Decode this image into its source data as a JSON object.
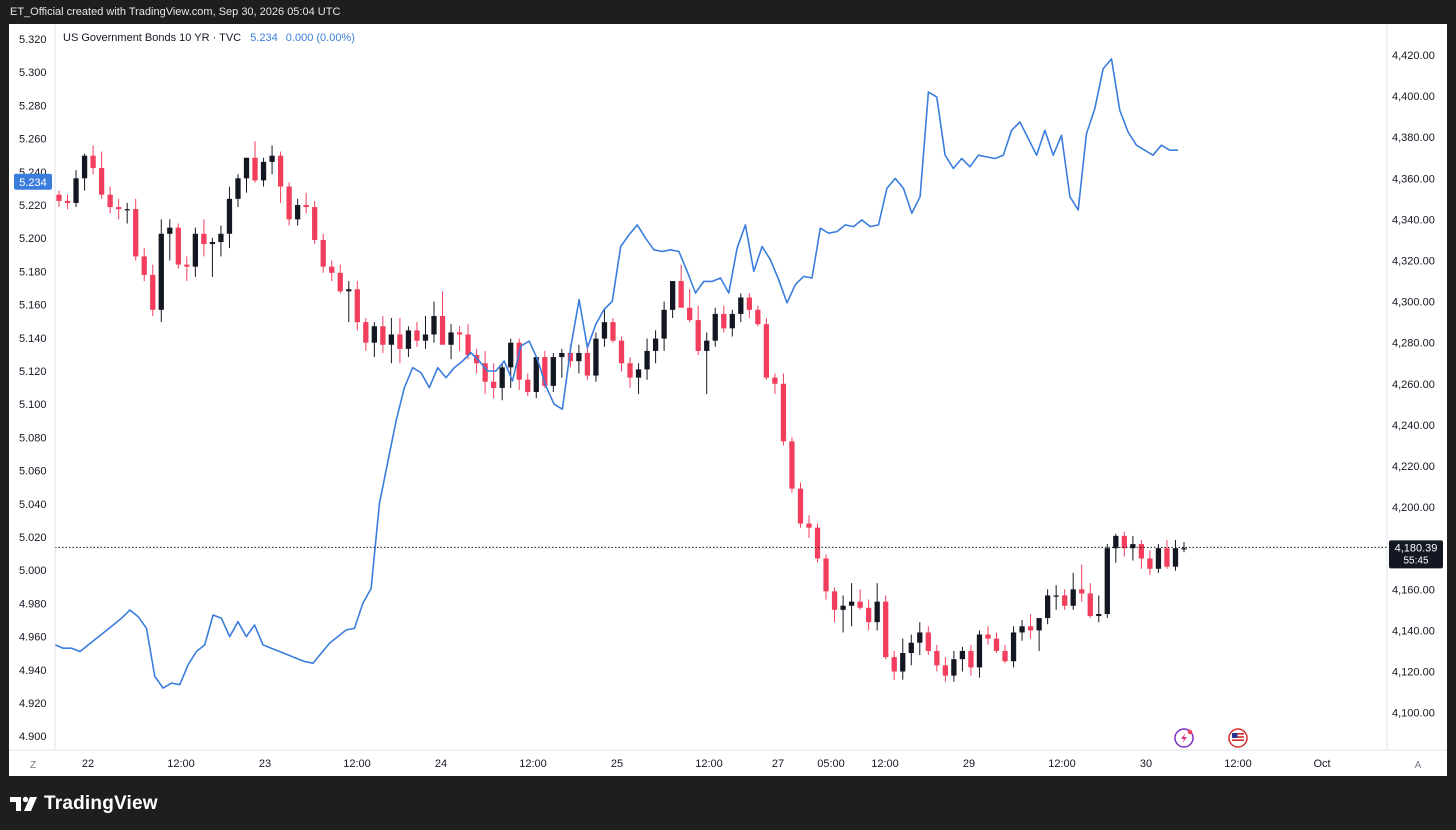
{
  "header": {
    "caption": "ET_Official created with TradingView.com, Sep 30, 2026 05:04 UTC"
  },
  "legend": {
    "symbol": "US Government Bonds 10 YR · TVC",
    "value": "5.234",
    "change": "0.000 (0.00%)"
  },
  "badges": {
    "left_price": "5.234",
    "right_price": "4,180.39",
    "right_countdown": "55:45"
  },
  "axis_corners": {
    "bottom_left": "Z",
    "bottom_right": "A"
  },
  "footer": {
    "brand": "TradingView"
  },
  "colors": {
    "line": "#3b7ddd",
    "up": "#131722",
    "down": "#f23e5c",
    "badge_left": "#3b7ddd",
    "badge_right": "#131722"
  },
  "chart_data": {
    "type": "line",
    "left_axis": {
      "ticks": [
        "5.320",
        "5.300",
        "5.280",
        "5.260",
        "5.240",
        "5.220",
        "5.200",
        "5.180",
        "5.160",
        "5.140",
        "5.120",
        "5.100",
        "5.080",
        "5.060",
        "5.040",
        "5.020",
        "5.000",
        "4.980",
        "4.960",
        "4.940",
        "4.920",
        "4.900"
      ],
      "range": [
        4.9,
        5.32
      ]
    },
    "right_axis": {
      "ticks": [
        "4,420.00",
        "4,400.00",
        "4,380.00",
        "4,360.00",
        "4,340.00",
        "4,320.00",
        "4,300.00",
        "4,280.00",
        "4,260.00",
        "4,240.00",
        "4,220.00",
        "4,200.00",
        "4,180.00",
        "4,160.00",
        "4,140.00",
        "4,120.00",
        "4,100.00"
      ],
      "range": [
        4094,
        4427
      ]
    },
    "x_axis": {
      "ticks": [
        "22",
        "12:00",
        "23",
        "12:00",
        "24",
        "12:00",
        "25",
        "12:00",
        "27",
        "05:00",
        "12:00",
        "29",
        "12:00",
        "30",
        "12:00",
        "Oct"
      ]
    },
    "series": [
      {
        "name": "US Government Bonds 10 YR",
        "axis": "left",
        "values": [
          4.955,
          4.953,
          4.953,
          4.951,
          4.955,
          4.959,
          4.963,
          4.967,
          4.971,
          4.976,
          4.972,
          4.965,
          4.936,
          4.929,
          4.932,
          4.931,
          4.943,
          4.951,
          4.955,
          4.973,
          4.971,
          4.96,
          4.969,
          4.96,
          4.967,
          4.955,
          4.953,
          4.951,
          4.949,
          4.947,
          4.945,
          4.944,
          4.95,
          4.956,
          4.96,
          4.964,
          4.965,
          4.98,
          4.989,
          5.04,
          5.065,
          5.09,
          5.11,
          5.122,
          5.119,
          5.11,
          5.122,
          5.116,
          5.122,
          5.126,
          5.131,
          5.126,
          5.12,
          5.12,
          5.126,
          5.114,
          5.135,
          5.138,
          5.127,
          5.111,
          5.1,
          5.097,
          5.134,
          5.163,
          5.134,
          5.148,
          5.157,
          5.162,
          5.195,
          5.202,
          5.208,
          5.2,
          5.193,
          5.192,
          5.193,
          5.192,
          5.18,
          5.167,
          5.174,
          5.174,
          5.176,
          5.167,
          5.194,
          5.208,
          5.18,
          5.195,
          5.187,
          5.175,
          5.161,
          5.172,
          5.177,
          5.176,
          5.206,
          5.203,
          5.204,
          5.208,
          5.207,
          5.211,
          5.207,
          5.208,
          5.23,
          5.236,
          5.23,
          5.215,
          5.225,
          5.288,
          5.285,
          5.25,
          5.242,
          5.248,
          5.243,
          5.25,
          5.249,
          5.248,
          5.25,
          5.265,
          5.27,
          5.26,
          5.25,
          5.265,
          5.25,
          5.262,
          5.225,
          5.217,
          5.263,
          5.278,
          5.302,
          5.308,
          5.277,
          5.264,
          5.256,
          5.253,
          5.25,
          5.256,
          5.253,
          5.253
        ]
      }
    ],
    "candles": {
      "axis": "right",
      "description": "OHLC candlesticks, index values",
      "ohlc": [
        [
          4352,
          4354,
          4346,
          4349
        ],
        [
          4349,
          4352,
          4345,
          4348
        ],
        [
          4348,
          4364,
          4346,
          4360
        ],
        [
          4360,
          4372,
          4354,
          4371
        ],
        [
          4371,
          4376,
          4362,
          4365
        ],
        [
          4365,
          4373,
          4350,
          4352
        ],
        [
          4352,
          4356,
          4343,
          4346
        ],
        [
          4346,
          4350,
          4340,
          4345
        ],
        [
          4345,
          4348,
          4338,
          4345
        ],
        [
          4345,
          4350,
          4320,
          4322
        ],
        [
          4322,
          4326,
          4310,
          4313
        ],
        [
          4313,
          4318,
          4293,
          4296
        ],
        [
          4296,
          4340,
          4290,
          4333
        ],
        [
          4333,
          4340,
          4320,
          4336
        ],
        [
          4336,
          4338,
          4316,
          4318
        ],
        [
          4318,
          4322,
          4310,
          4317
        ],
        [
          4317,
          4336,
          4312,
          4333
        ],
        [
          4333,
          4340,
          4322,
          4328
        ],
        [
          4328,
          4331,
          4312,
          4329
        ],
        [
          4329,
          4337,
          4322,
          4333
        ],
        [
          4333,
          4356,
          4326,
          4350
        ],
        [
          4350,
          4362,
          4346,
          4360
        ],
        [
          4360,
          4370,
          4353,
          4370
        ],
        [
          4370,
          4378,
          4358,
          4359
        ],
        [
          4359,
          4370,
          4356,
          4368
        ],
        [
          4368,
          4376,
          4362,
          4371
        ],
        [
          4371,
          4373,
          4348,
          4356
        ],
        [
          4356,
          4358,
          4337,
          4340
        ],
        [
          4340,
          4350,
          4337,
          4347
        ],
        [
          4347,
          4353,
          4343,
          4346
        ],
        [
          4346,
          4349,
          4328,
          4330
        ],
        [
          4330,
          4333,
          4314,
          4317
        ],
        [
          4317,
          4320,
          4310,
          4314
        ],
        [
          4314,
          4318,
          4304,
          4305
        ],
        [
          4305,
          4310,
          4290,
          4306
        ],
        [
          4306,
          4310,
          4286,
          4290
        ],
        [
          4290,
          4292,
          4276,
          4280
        ],
        [
          4280,
          4290,
          4273,
          4288
        ],
        [
          4288,
          4293,
          4275,
          4279
        ],
        [
          4279,
          4292,
          4270,
          4284
        ],
        [
          4284,
          4292,
          4270,
          4277
        ],
        [
          4277,
          4288,
          4273,
          4286
        ],
        [
          4286,
          4290,
          4278,
          4281
        ],
        [
          4281,
          4293,
          4277,
          4284
        ],
        [
          4284,
          4300,
          4280,
          4293
        ],
        [
          4293,
          4305,
          4282,
          4279
        ],
        [
          4279,
          4289,
          4272,
          4285
        ],
        [
          4285,
          4288,
          4276,
          4284
        ],
        [
          4284,
          4289,
          4272,
          4274
        ],
        [
          4274,
          4277,
          4265,
          4270
        ],
        [
          4270,
          4276,
          4255,
          4261
        ],
        [
          4261,
          4270,
          4253,
          4258
        ],
        [
          4258,
          4270,
          4252,
          4268
        ],
        [
          4268,
          4282,
          4258,
          4280
        ],
        [
          4280,
          4282,
          4257,
          4262
        ],
        [
          4262,
          4265,
          4254,
          4256
        ],
        [
          4256,
          4267,
          4253,
          4273
        ],
        [
          4273,
          4276,
          4258,
          4259
        ],
        [
          4259,
          4275,
          4256,
          4273
        ],
        [
          4273,
          4277,
          4263,
          4275
        ],
        [
          4275,
          4279,
          4268,
          4271
        ],
        [
          4271,
          4279,
          4265,
          4275
        ],
        [
          4275,
          4280,
          4262,
          4264
        ],
        [
          4264,
          4285,
          4261,
          4282
        ],
        [
          4282,
          4296,
          4278,
          4290
        ],
        [
          4290,
          4292,
          4280,
          4281
        ],
        [
          4281,
          4283,
          4266,
          4270
        ],
        [
          4270,
          4273,
          4258,
          4263
        ],
        [
          4263,
          4270,
          4255,
          4267
        ],
        [
          4267,
          4282,
          4262,
          4276
        ],
        [
          4276,
          4286,
          4270,
          4282
        ],
        [
          4282,
          4300,
          4276,
          4296
        ],
        [
          4296,
          4310,
          4292,
          4310
        ],
        [
          4310,
          4318,
          4304,
          4297
        ],
        [
          4297,
          4306,
          4290,
          4291
        ],
        [
          4291,
          4298,
          4274,
          4276
        ],
        [
          4276,
          4285,
          4255,
          4281
        ],
        [
          4281,
          4297,
          4278,
          4294
        ],
        [
          4294,
          4298,
          4285,
          4287
        ],
        [
          4287,
          4296,
          4283,
          4294
        ],
        [
          4294,
          4304,
          4290,
          4302
        ],
        [
          4302,
          4304,
          4292,
          4296
        ],
        [
          4296,
          4298,
          4288,
          4289
        ],
        [
          4289,
          4292,
          4262,
          4263
        ],
        [
          4263,
          4265,
          4255,
          4260
        ],
        [
          4260,
          4265,
          4230,
          4232
        ],
        [
          4232,
          4234,
          4207,
          4209
        ],
        [
          4209,
          4212,
          4190,
          4192
        ],
        [
          4192,
          4196,
          4185,
          4190
        ],
        [
          4190,
          4192,
          4173,
          4175
        ],
        [
          4175,
          4177,
          4155,
          4159
        ],
        [
          4159,
          4161,
          4144,
          4150
        ],
        [
          4150,
          4157,
          4139,
          4152
        ],
        [
          4152,
          4163,
          4142,
          4154
        ],
        [
          4154,
          4160,
          4150,
          4151
        ],
        [
          4151,
          4155,
          4140,
          4144
        ],
        [
          4144,
          4163,
          4140,
          4154
        ],
        [
          4154,
          4157,
          4126,
          4127
        ],
        [
          4127,
          4130,
          4116,
          4120
        ],
        [
          4120,
          4136,
          4116,
          4129
        ],
        [
          4129,
          4138,
          4123,
          4134
        ],
        [
          4134,
          4144,
          4128,
          4139
        ],
        [
          4139,
          4142,
          4128,
          4130
        ],
        [
          4130,
          4133,
          4120,
          4123
        ],
        [
          4123,
          4127,
          4115,
          4118
        ],
        [
          4118,
          4130,
          4115,
          4126
        ],
        [
          4126,
          4132,
          4120,
          4130
        ],
        [
          4130,
          4133,
          4118,
          4122
        ],
        [
          4122,
          4140,
          4117,
          4138
        ],
        [
          4138,
          4142,
          4133,
          4136
        ],
        [
          4136,
          4139,
          4129,
          4130
        ],
        [
          4130,
          4133,
          4124,
          4125
        ],
        [
          4125,
          4142,
          4122,
          4139
        ],
        [
          4139,
          4145,
          4135,
          4142
        ],
        [
          4142,
          4148,
          4136,
          4140
        ],
        [
          4140,
          4146,
          4130,
          4146
        ],
        [
          4146,
          4160,
          4143,
          4157
        ],
        [
          4157,
          4162,
          4150,
          4157
        ],
        [
          4157,
          4160,
          4150,
          4152
        ],
        [
          4152,
          4168,
          4150,
          4160
        ],
        [
          4160,
          4172,
          4154,
          4158
        ],
        [
          4158,
          4163,
          4146,
          4147
        ],
        [
          4147,
          4157,
          4144,
          4148
        ],
        [
          4148,
          4182,
          4146,
          4180
        ],
        [
          4180,
          4187,
          4173,
          4186
        ],
        [
          4186,
          4188,
          4176,
          4180
        ],
        [
          4180,
          4186,
          4174,
          4182
        ],
        [
          4182,
          4184,
          4170,
          4175
        ],
        [
          4175,
          4179,
          4167,
          4170
        ],
        [
          4170,
          4182,
          4168,
          4180
        ],
        [
          4180,
          4184,
          4170,
          4171
        ],
        [
          4171,
          4184,
          4169,
          4180
        ],
        [
          4180,
          4183,
          4178,
          4180
        ]
      ]
    },
    "last_price_line": 4180.39,
    "grid": false
  }
}
